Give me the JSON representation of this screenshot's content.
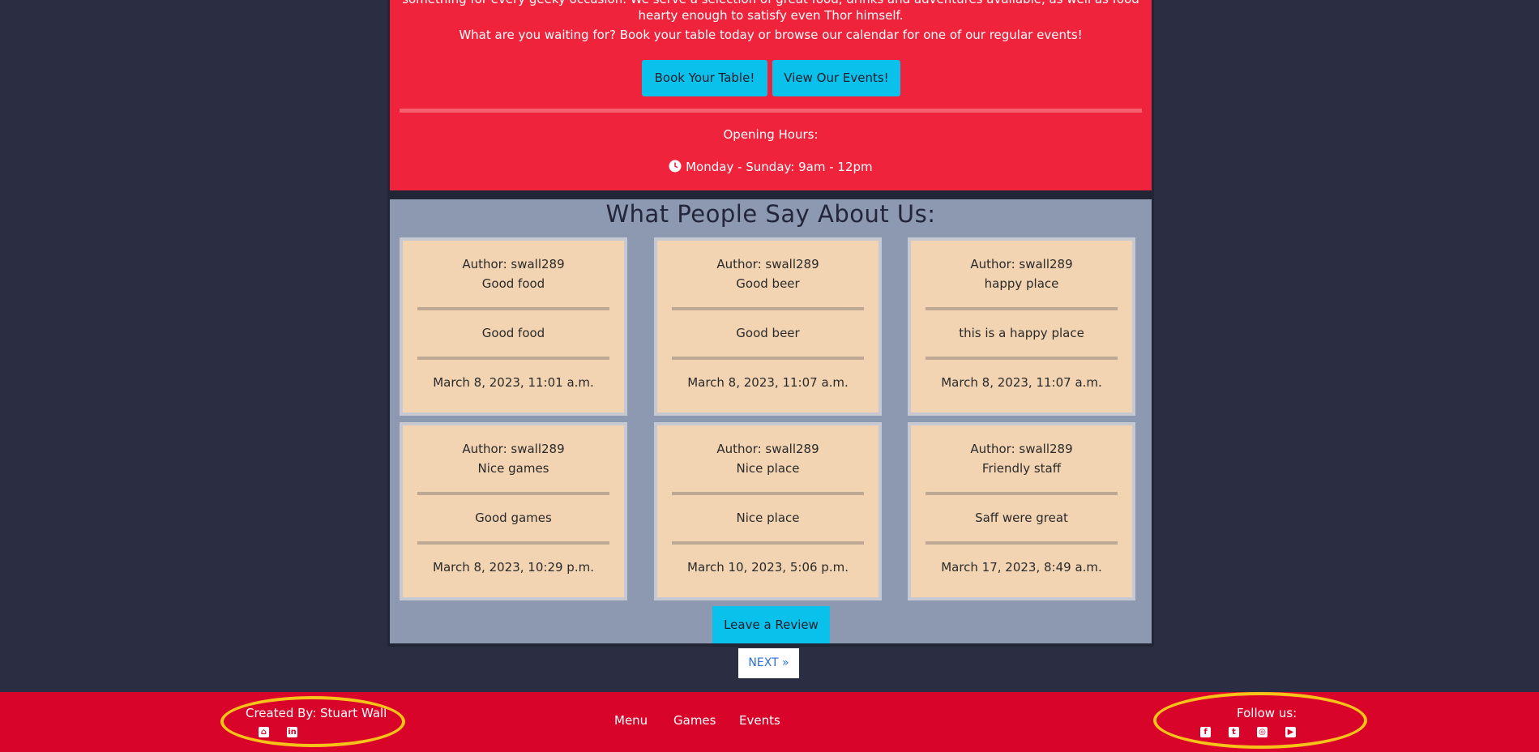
{
  "hero": {
    "cut_line_1": "something for every geeky occasion. We serve a selection of great food, drinks and adventures available, as well as food",
    "cut_line_2": "hearty enough to satisfy even Thor himself.",
    "line_3": "What are you waiting for? Book your table today or browse our calendar for one of our regular events!",
    "book_button": "Book Your Table!",
    "events_button": "View Our Events!",
    "hours_heading": "Opening Hours:",
    "hours_text": "Monday - Sunday: 9am - 12pm"
  },
  "reviews": {
    "heading": "What People Say About Us:",
    "cards": [
      {
        "author": "Author: swall289",
        "title": "Good food",
        "body": "Good food",
        "date": "March 8, 2023, 11:01 a.m."
      },
      {
        "author": "Author: swall289",
        "title": "Good beer",
        "body": "Good beer",
        "date": "March 8, 2023, 11:07 a.m."
      },
      {
        "author": "Author: swall289",
        "title": "happy place",
        "body": "this is a happy place",
        "date": "March 8, 2023, 11:07 a.m."
      },
      {
        "author": "Author: swall289",
        "title": "Nice games",
        "body": "Good games",
        "date": "March 8, 2023, 10:29 p.m."
      },
      {
        "author": "Author: swall289",
        "title": "Nice place",
        "body": "Nice place",
        "date": "March 10, 2023, 5:06 p.m."
      },
      {
        "author": "Author: swall289",
        "title": "Friendly staff",
        "body": "Saff were great",
        "date": "March 17, 2023, 8:49 a.m."
      }
    ],
    "leave_button": "Leave a Review"
  },
  "pagination": {
    "next": "NEXT »"
  },
  "footer": {
    "created_by": "Created By: Stuart Wall",
    "nav": [
      "Menu",
      "Games",
      "Events"
    ],
    "follow": "Follow us:",
    "social_icons": [
      "facebook-icon",
      "twitter-icon",
      "instagram-icon",
      "youtube-icon"
    ]
  },
  "colors": {
    "page_bg": "#2b2e42",
    "hero_red": "#ef233c",
    "review_bg": "#8d99b0",
    "card_bg": "#f2d4b2",
    "button_cyan": "#0ac1eb",
    "footer_red": "#d90429",
    "highlight_yellow": "#f6c418"
  }
}
